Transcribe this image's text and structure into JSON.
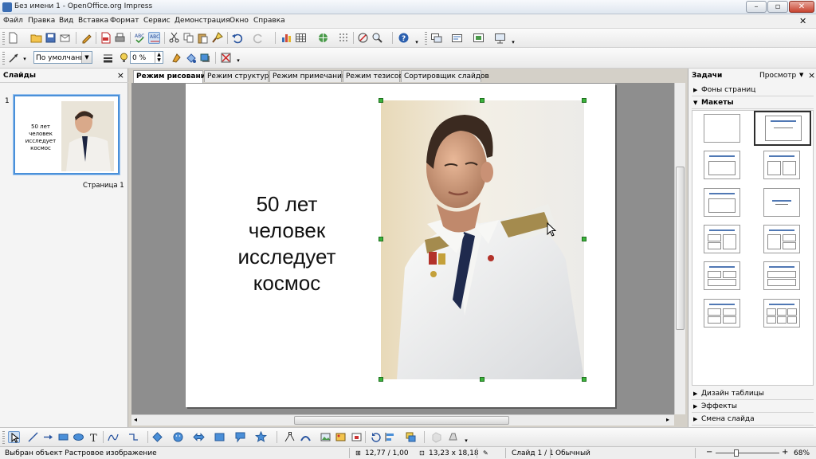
{
  "window": {
    "title": "Без имени 1 - OpenOffice.org Impress"
  },
  "menu": [
    "Файл",
    "Правка",
    "Вид",
    "Вставка",
    "Формат",
    "Сервис",
    "Демонстрация",
    "Окно",
    "Справка"
  ],
  "line_toolbar": {
    "line_style": "По умолчани",
    "transparency": "0 %"
  },
  "slides_pane": {
    "title": "Слайды",
    "close": "×",
    "slide_number": "1",
    "slide_label": "Страница 1",
    "thumb_text": [
      "50 лет",
      "человек",
      "исследует",
      "космос"
    ]
  },
  "tabs": [
    {
      "label": "Режим рисования",
      "active": true
    },
    {
      "label": "Режим структуры",
      "active": false
    },
    {
      "label": "Режим примечаний",
      "active": false
    },
    {
      "label": "Режим тезисов",
      "active": false
    },
    {
      "label": "Сортировщик слайдов",
      "active": false
    }
  ],
  "slide": {
    "text_lines": [
      "50 лет",
      "человек",
      "исследует",
      "космос"
    ]
  },
  "tasks_pane": {
    "title": "Задачи",
    "view_menu": "Просмотр",
    "close": "×",
    "sections_top": [
      "Фоны страниц",
      "Макеты"
    ],
    "sections_bottom": [
      "Дизайн таблицы",
      "Эффекты",
      "Смена слайда"
    ]
  },
  "status": {
    "selection": "Выбран объект Растровое изображение",
    "position": "12,77 / 1,00",
    "size": "13,23 x 18,18",
    "slide": "Слайд 1 / 1",
    "layout": "Обычный",
    "zoom": "68%"
  },
  "colors": {
    "accent": "#4a90d9",
    "handle": "#3cb33c",
    "workspace": "#8e8e8e"
  }
}
